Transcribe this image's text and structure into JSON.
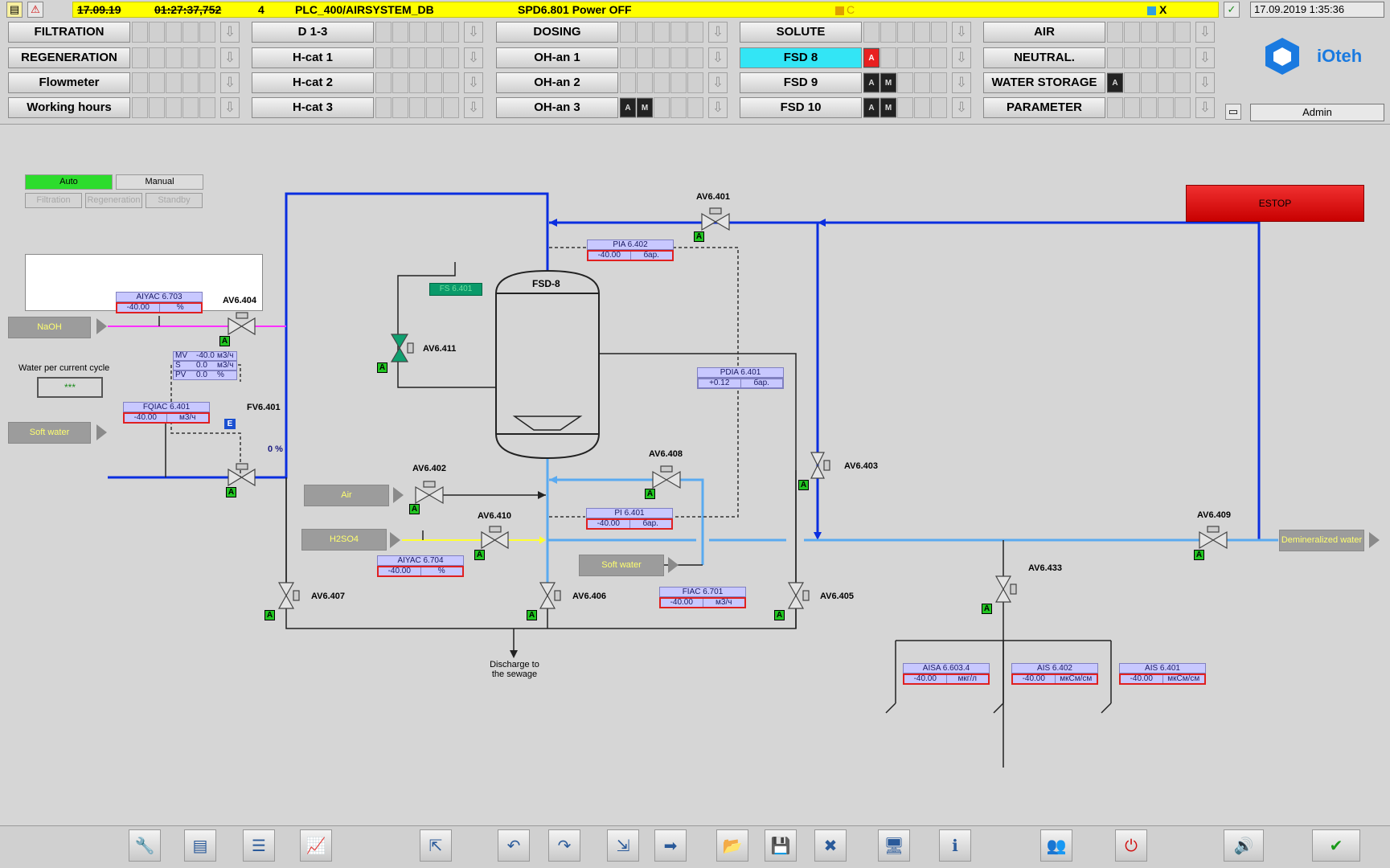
{
  "header": {
    "alarm": {
      "date": "17.09.19",
      "time": "01:27:37,752",
      "priority": "4",
      "source": "PLC_400/AIRSYSTEM_DB",
      "message": "SPD6.801 Power OFF",
      "flag": "C",
      "ack": "X"
    },
    "datetime": "17.09.2019 1:35:36",
    "user": "Admin",
    "logo_text": "iOteh",
    "nav": [
      [
        {
          "label": "FILTRATION"
        },
        {
          "label": "D 1-3"
        },
        {
          "label": "DOSING"
        },
        {
          "label": "SOLUTE"
        },
        {
          "label": "AIR"
        }
      ],
      [
        {
          "label": "REGENERATION"
        },
        {
          "label": "H-cat 1"
        },
        {
          "label": "OH-an 1"
        },
        {
          "label": "FSD 8",
          "active": true
        },
        {
          "label": "NEUTRAL."
        }
      ],
      [
        {
          "label": "Flowmeter"
        },
        {
          "label": "H-cat 2"
        },
        {
          "label": "OH-an 2"
        },
        {
          "label": "FSD 9"
        },
        {
          "label": "WATER STORAGE"
        }
      ],
      [
        {
          "label": "Working hours"
        },
        {
          "label": "H-cat 3"
        },
        {
          "label": "OH-an 3"
        },
        {
          "label": "FSD 10"
        },
        {
          "label": "PARAMETER"
        }
      ]
    ],
    "badges": {
      "a": "A",
      "m": "M"
    }
  },
  "plant": {
    "modes": {
      "auto": "Auto",
      "manual": "Manual",
      "filtration": "Filtration",
      "regeneration": "Regeneration",
      "standby": "Standby"
    },
    "estop": "ESTOP",
    "vessel": "FSD-8",
    "flow_switch": "FS 6.401",
    "water_per_cycle_label": "Water per current cycle",
    "water_per_cycle_value": "***",
    "fv_percent": "0 %",
    "mv": {
      "mv_label": "MV",
      "mv_val": "-40.0",
      "mv_unit": "м3/ч",
      "s_label": "S",
      "s_val": "0.0",
      "s_unit": "м3/ч",
      "pv_label": "PV",
      "pv_val": "0.0",
      "pv_unit": "%"
    },
    "mediums": {
      "naoh": "NaOH",
      "soft_water_in": "Soft water",
      "air": "Air",
      "h2so4": "H2SO4",
      "soft_water_2": "Soft water",
      "demin": "Demineralized water"
    },
    "discharge": "Discharge to the sewage",
    "valves": {
      "av6401": "AV6.401",
      "av6404": "AV6.404",
      "av6411": "AV6.411",
      "fv6401": "FV6.401",
      "av6402": "AV6.402",
      "av6410": "AV6.410",
      "av6408": "AV6.408",
      "av6403": "AV6.403",
      "av6407": "AV6.407",
      "av6406": "AV6.406",
      "av6405": "AV6.405",
      "av6409": "AV6.409",
      "av6433": "AV6.433"
    },
    "auto_badge": "A",
    "ext_badge": "E",
    "indicators": {
      "aiyac6703": {
        "tag": "AIYAC 6.703",
        "value": "-40.00",
        "unit": "%"
      },
      "pia6402": {
        "tag": "PIA 6.402",
        "value": "-40.00",
        "unit": "бар."
      },
      "fqiac6401": {
        "tag": "FQIAC 6.401",
        "value": "-40.00",
        "unit": "м3/ч"
      },
      "pdia6401": {
        "tag": "PDIA 6.401",
        "value": "+0.12",
        "unit": "бар."
      },
      "pi6401": {
        "tag": "PI 6.401",
        "value": "-40.00",
        "unit": "бар."
      },
      "aiyac6704": {
        "tag": "AIYAC 6.704",
        "value": "-40.00",
        "unit": "%"
      },
      "fiac6701": {
        "tag": "FIAC 6.701",
        "value": "-40.00",
        "unit": "м3/ч"
      },
      "aisa66034": {
        "tag": "AISA 6.603.4",
        "value": "-40.00",
        "unit": "мкг/л"
      },
      "ais6402": {
        "tag": "AIS 6.402",
        "value": "-40.00",
        "unit": "мкСм/см"
      },
      "ais6401": {
        "tag": "AIS 6.401",
        "value": "-40.00",
        "unit": "мкСм/см"
      }
    }
  },
  "colors": {
    "blue_line": "#0a2ee0",
    "light_blue_line": "#5aaaf0",
    "naoh_line": "#ff30ff",
    "acid_line": "#ffff30",
    "active_nav": "#33e5f5"
  },
  "footer_icons": [
    "tools-icon",
    "notes-icon",
    "list-icon",
    "trend-icon",
    "export-icon",
    "undo-icon",
    "redo-icon",
    "import-icon",
    "forward-icon",
    "open-folder-icon",
    "save-icon",
    "delete-icon",
    "monitor-icon",
    "info-icon",
    "users-icon",
    "power-icon",
    "sound-icon",
    "ack-all-icon"
  ]
}
